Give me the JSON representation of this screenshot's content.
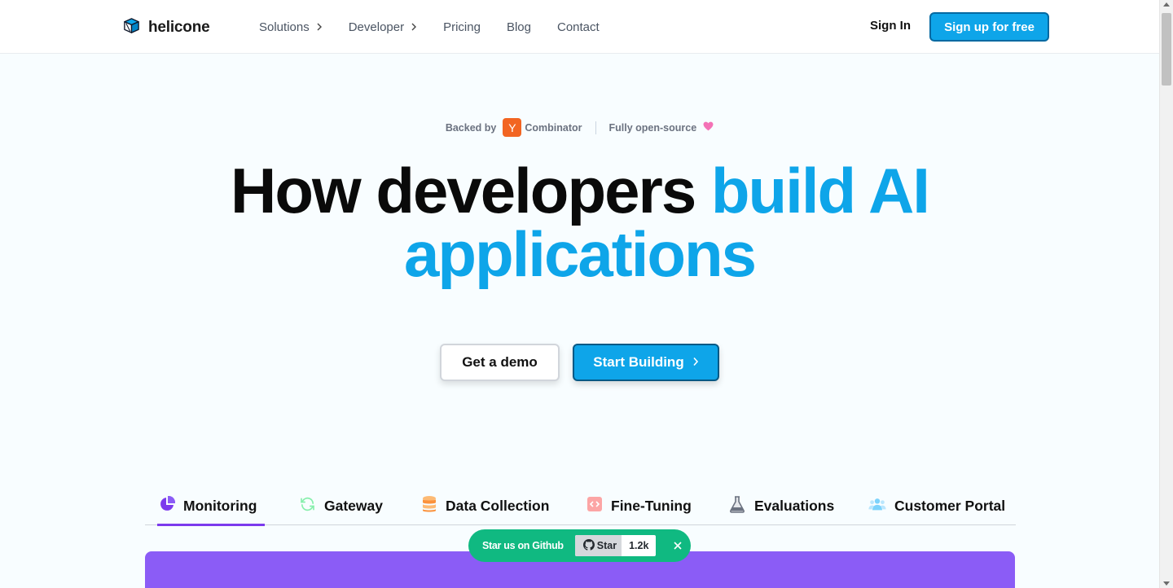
{
  "navbar": {
    "brand": "helicone",
    "items": [
      {
        "label": "Solutions",
        "has_chevron": true,
        "icon": "chevron-right-icon"
      },
      {
        "label": "Developer",
        "has_chevron": true,
        "icon": "chevron-right-icon"
      },
      {
        "label": "Pricing",
        "has_chevron": false
      },
      {
        "label": "Blog",
        "has_chevron": false
      },
      {
        "label": "Contact",
        "has_chevron": false
      }
    ],
    "sign_in": "Sign In",
    "sign_up": "Sign up for free"
  },
  "backed": {
    "prefix": "Backed by",
    "yc_letter": "Y",
    "yc_text": "Combinator",
    "open_source": "Fully open-source",
    "heart_icon": "heart-icon"
  },
  "hero": {
    "dark_part": "How developers",
    "blue_part": "build AI",
    "line2": "applications"
  },
  "cta": {
    "demo": "Get a demo",
    "build": "Start Building"
  },
  "tabs": [
    {
      "label": "Monitoring",
      "icon": "pie-chart-icon",
      "active": true
    },
    {
      "label": "Gateway",
      "icon": "refresh-icon",
      "active": false
    },
    {
      "label": "Data Collection",
      "icon": "database-icon",
      "active": false
    },
    {
      "label": "Fine-Tuning",
      "icon": "code-icon",
      "active": false
    },
    {
      "label": "Evaluations",
      "icon": "flask-icon",
      "active": false
    },
    {
      "label": "Customer Portal",
      "icon": "users-icon",
      "active": false
    }
  ],
  "github": {
    "label": "Star us on Github",
    "star": "Star",
    "count": "1.2k"
  },
  "colors": {
    "accent_blue": "#0ea5e9",
    "tab_active": "#7c3aed",
    "panel": "#8b5cf6",
    "github_pill": "#10b981",
    "yc_orange": "#f26522"
  }
}
